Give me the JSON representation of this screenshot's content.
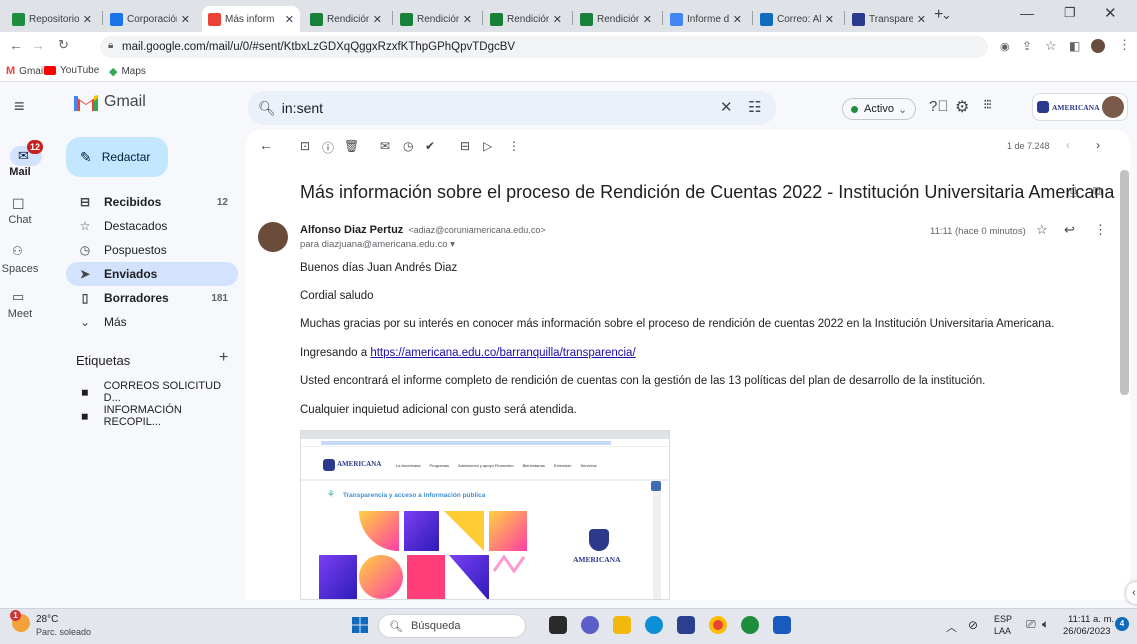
{
  "browser": {
    "tabs": [
      {
        "label": "Repositorio",
        "icon": "drive-icon",
        "color": "#1e8e3e",
        "active": false
      },
      {
        "label": "Corporación",
        "icon": "docs-icon",
        "color": "#1a73e8",
        "active": false
      },
      {
        "label": "Más inform",
        "icon": "gmail-icon",
        "color": "#ea4335",
        "active": true
      },
      {
        "label": "Rendición",
        "icon": "sheets-icon",
        "color": "#188038",
        "active": false
      },
      {
        "label": "Rendición",
        "icon": "sheets-icon",
        "color": "#188038",
        "active": false
      },
      {
        "label": "Rendición",
        "icon": "sheets-icon",
        "color": "#188038",
        "active": false
      },
      {
        "label": "Rendición",
        "icon": "sheets-icon",
        "color": "#188038",
        "active": false
      },
      {
        "label": "Informe de",
        "icon": "forms-icon",
        "color": "#4285f4",
        "active": false
      },
      {
        "label": "Correo: Alf",
        "icon": "outlook-icon",
        "color": "#0f6cbd",
        "active": false
      },
      {
        "label": "Transparen",
        "icon": "shield-icon",
        "color": "#2b3a8c",
        "active": false
      }
    ],
    "new_tab": "+",
    "url": "mail.google.com/mail/u/0/#sent/KtbxLzGDXqQggxRzxfKThpGPhQpvTDgcBV",
    "bookmarks": [
      {
        "label": "Gmail"
      },
      {
        "label": "YouTube"
      },
      {
        "label": "Maps"
      }
    ]
  },
  "gmail": {
    "logo": "Gmail",
    "search_value": "in:sent",
    "status": "Activo",
    "org_logo": "AMERICANA",
    "rail": [
      {
        "label": "Mail",
        "badge": "12"
      },
      {
        "label": "Chat"
      },
      {
        "label": "Spaces"
      },
      {
        "label": "Meet"
      }
    ],
    "compose": "Redactar",
    "nav": [
      {
        "label": "Recibidos",
        "count": "12",
        "icon": "inbox-icon"
      },
      {
        "label": "Destacados",
        "count": "",
        "icon": "star-icon"
      },
      {
        "label": "Pospuestos",
        "count": "",
        "icon": "clock-icon"
      },
      {
        "label": "Enviados",
        "count": "",
        "icon": "send-icon"
      },
      {
        "label": "Borradores",
        "count": "181",
        "icon": "draft-icon"
      },
      {
        "label": "Más",
        "count": "",
        "icon": "chevron-down-icon"
      }
    ],
    "labels_title": "Etiquetas",
    "labels": [
      {
        "label": "CORREOS SOLICITUD D..."
      },
      {
        "label": "INFORMACIÓN RECOPIL..."
      }
    ],
    "pagination": "1 de 7.248",
    "email": {
      "subject": "Más información sobre el proceso de Rendición de Cuentas 2022 - Institución Universitaria Americana",
      "sender_name": "Alfonso Diaz Pertuz",
      "sender_email": "<adiaz@coruniamericana.edu.co>",
      "to": "para diazjuana@americana.edu.co",
      "time": "11:11 (hace 0 minutos)",
      "greeting": "Buenos días Juan Andrés Diaz",
      "salute": "Cordial saludo",
      "p1": "Muchas gracias por su interés en conocer más información sobre el proceso de rendición de cuentas 2022 en la Institución Universitaria Americana.",
      "p2_prefix": "Ingresando a ",
      "p2_link": "https://americana.edu.co/barranquilla/transparencia/",
      "p3": "Usted encontrará el informe completo de rendición de cuentas con la gestión de las 13 políticas del plan de desarrollo de la institución.",
      "p4": "Cualquier inquietud adicional con gusto será atendida.",
      "embedded": {
        "nav": [
          "La Americana",
          "Programas",
          "Admisiones y apoyo Financiero",
          "Bienestarías",
          "Extensión",
          "Servicios"
        ],
        "banner": "Transparencia y acceso a información pública",
        "logo": "AMERICANA"
      }
    }
  },
  "taskbar": {
    "temp": "28°C",
    "weather": "Parc. soleado",
    "search": "Búsqueda",
    "lang": "ESP",
    "lang2": "LAA",
    "time": "11:11 a. m.",
    "date": "26/06/2023",
    "weather_badge": "1",
    "notif_badge": "4"
  }
}
